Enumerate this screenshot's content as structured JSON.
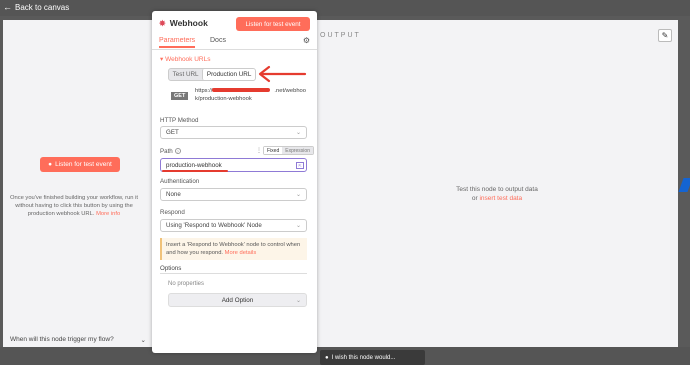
{
  "canvas": {
    "back_label": "Back to canvas"
  },
  "input_panel": {
    "listen_button": "Listen for test event",
    "description": "Once you've finished building your workflow, run it without having to click this button by using the production webhook URL.",
    "more_info": "More info",
    "trigger_question": "When will this node trigger my flow?"
  },
  "node": {
    "title": "Webhook",
    "listen_button": "Listen for test event",
    "tabs": [
      {
        "label": "Parameters",
        "active": true
      },
      {
        "label": "Docs",
        "active": false
      }
    ],
    "webhook_urls_label": "Webhook URLs",
    "url_toggle": {
      "test": "Test URL",
      "production": "Production URL",
      "selected": "production"
    },
    "method_badge": "GET",
    "url_prefix": "https://",
    "url_suffix": ".net/webhook/production-webhook",
    "http_method_label": "HTTP Method",
    "http_method_value": "GET",
    "path_label": "Path",
    "path_mode": {
      "fixed": "Fixed",
      "expression": "Expression"
    },
    "path_value": "production-webhook",
    "authentication_label": "Authentication",
    "authentication_value": "None",
    "respond_label": "Respond",
    "respond_value": "Using 'Respond to Webhook' Node",
    "notice_text": "Insert a 'Respond to Webhook' node to control when and how you respond.",
    "notice_link": "More details",
    "options_label": "Options",
    "no_properties": "No properties",
    "add_option": "Add Option"
  },
  "output_panel": {
    "title": "OUTPUT",
    "message": "Test this node to output data",
    "or_text": "or",
    "insert_link": "insert test data"
  },
  "footer": {
    "wish": "I wish this node would..."
  },
  "colors": {
    "accent": "#ff6d5a",
    "annotation_red": "#e53b2f",
    "expression_purple": "#8f7ad6"
  }
}
